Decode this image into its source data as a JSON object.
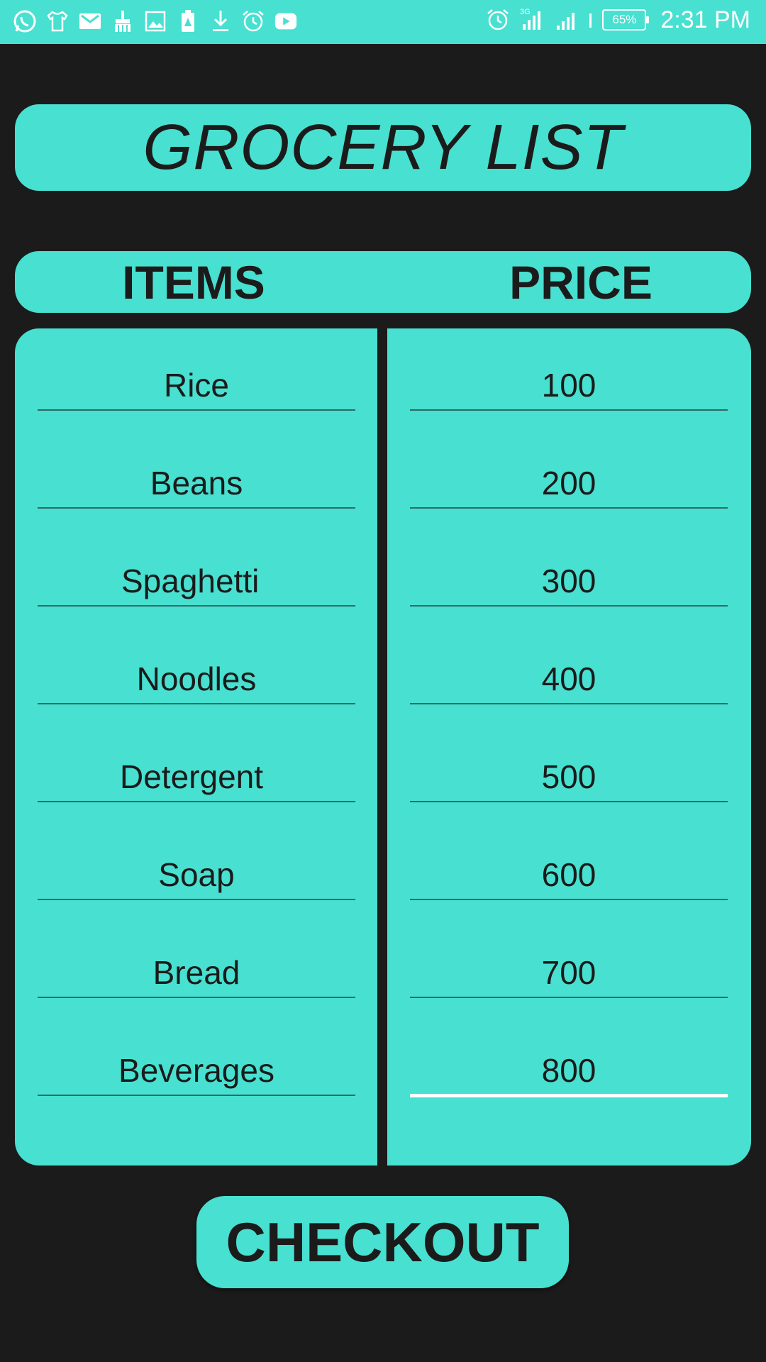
{
  "status_bar": {
    "time": "2:31 PM",
    "battery_percent": "65%",
    "network_label": "3G",
    "left_icons": [
      "whatsapp-icon",
      "shirt-icon",
      "gmail-icon",
      "broom-icon",
      "image-icon",
      "battery-saver-icon",
      "download-icon",
      "alarm-icon",
      "youtube-icon"
    ],
    "right_icons": [
      "alarm-icon",
      "signal-icon",
      "signal-icon",
      "vibrate-icon",
      "battery-icon"
    ]
  },
  "title": "GROCERY LIST",
  "header": {
    "items_label": "ITEMS",
    "price_label": "PRICE"
  },
  "items": [
    {
      "name": "Rice",
      "price": "100"
    },
    {
      "name": "Beans",
      "price": "200"
    },
    {
      "name": "Spaghetti",
      "price": "300"
    },
    {
      "name": "Noodles",
      "price": "400"
    },
    {
      "name": "Detergent",
      "price": "500"
    },
    {
      "name": "Soap",
      "price": "600"
    },
    {
      "name": "Bread",
      "price": "700"
    },
    {
      "name": "Beverages",
      "price": "800"
    }
  ],
  "checkout_label": "CHECKOUT",
  "colors": {
    "accent": "#48e0d0",
    "background": "#1b1b1b",
    "text": "#1b1b1b",
    "underline": "#2e6b66",
    "active_underline": "#ffffff"
  }
}
